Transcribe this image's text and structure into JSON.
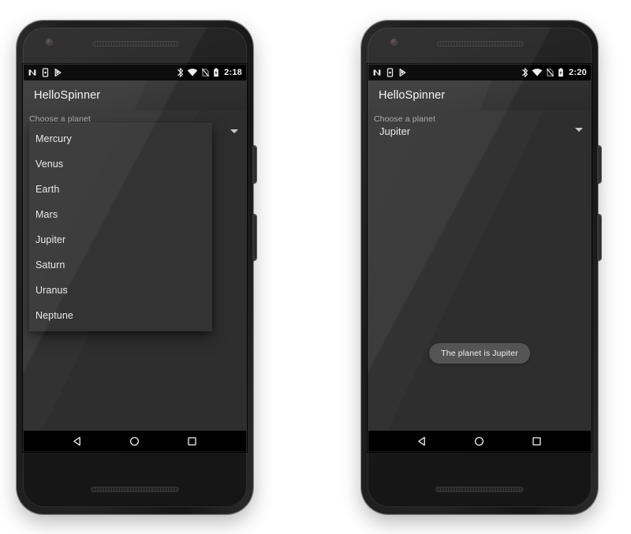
{
  "app": {
    "title": "HelloSpinner",
    "field_label": "Choose a planet"
  },
  "planets": [
    "Mercury",
    "Venus",
    "Earth",
    "Mars",
    "Jupiter",
    "Saturn",
    "Uranus",
    "Neptune"
  ],
  "phone_left": {
    "status_bar": {
      "time": "2:18",
      "left_icons": [
        "nfc-n-icon",
        "vibrate-icon",
        "flag-icon"
      ],
      "right_icons": [
        "bluetooth-icon",
        "wifi-icon",
        "no-sim-icon",
        "battery-charging-icon"
      ]
    },
    "spinner": {
      "expanded": true,
      "selected": "Mercury",
      "arrow_icon": "dropdown-arrow-icon"
    },
    "toast": null,
    "nav_bar": [
      "back-icon",
      "home-icon",
      "recents-icon"
    ]
  },
  "phone_right": {
    "status_bar": {
      "time": "2:20",
      "left_icons": [
        "nfc-n-icon",
        "vibrate-icon",
        "flag-icon"
      ],
      "right_icons": [
        "bluetooth-icon",
        "wifi-icon",
        "no-sim-icon",
        "battery-charging-icon"
      ]
    },
    "spinner": {
      "expanded": false,
      "selected": "Jupiter",
      "arrow_icon": "dropdown-arrow-icon"
    },
    "toast": "The planet is Jupiter",
    "nav_bar": [
      "back-icon",
      "home-icon",
      "recents-icon"
    ]
  },
  "colors": {
    "page_background": "#ffffff",
    "screen_background": "#2e2e2e",
    "app_bar": "#2e2e2e",
    "status_bar": "#000000",
    "nav_bar": "#000000",
    "dropdown_background": "#333333",
    "toast_background": "#545454",
    "primary_text": "#eaeaea",
    "secondary_text": "#a8a8a8"
  }
}
